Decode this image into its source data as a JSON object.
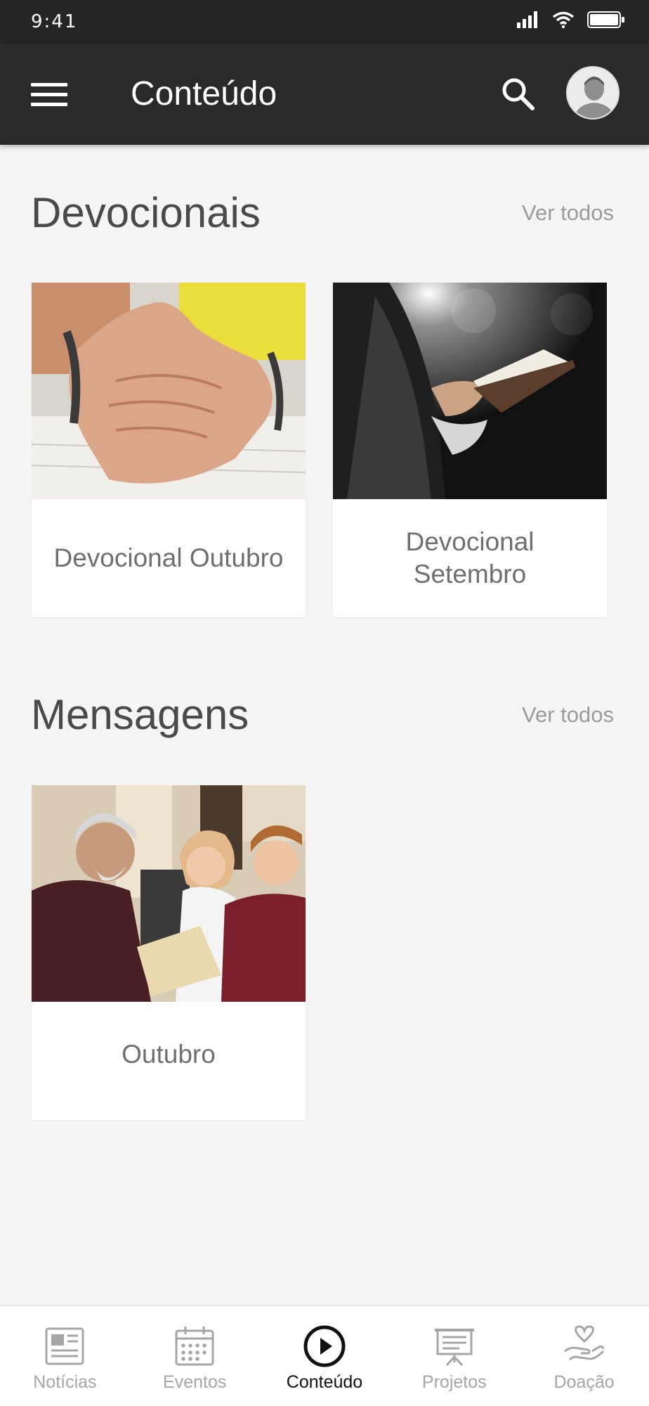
{
  "status": {
    "time": "9:41"
  },
  "header": {
    "title": "Conteúdo"
  },
  "devocionais": {
    "title": "Devocionais",
    "see_all": "Ver todos",
    "items": [
      {
        "label": "Devocional Outubro"
      },
      {
        "label": "Devocional Setembro"
      }
    ]
  },
  "mensagens": {
    "title": "Mensagens",
    "see_all": "Ver todos",
    "items": [
      {
        "label": "Outubro"
      }
    ]
  },
  "nav": {
    "items": [
      {
        "label": "Notícias",
        "icon": "newspaper-icon"
      },
      {
        "label": "Eventos",
        "icon": "calendar-icon"
      },
      {
        "label": "Conteúdo",
        "icon": "play-circle-icon",
        "active": true
      },
      {
        "label": "Projetos",
        "icon": "presentation-board-icon"
      },
      {
        "label": "Doação",
        "icon": "hand-heart-icon"
      }
    ]
  },
  "colors": {
    "header_bg": "#2a2a2a",
    "page_bg": "#f5f5f5",
    "active_nav": "#111111",
    "inactive_nav": "#a6a6a6"
  }
}
